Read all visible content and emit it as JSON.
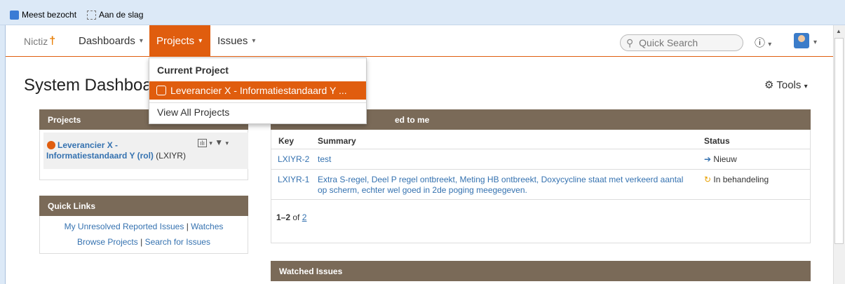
{
  "bookmarks": {
    "most_visited": "Meest bezocht",
    "getting_started": "Aan de slag"
  },
  "header": {
    "logo": "Nictiz",
    "nav": {
      "dashboards": "Dashboards",
      "projects": "Projects",
      "issues": "Issues"
    },
    "search_placeholder": "Quick Search",
    "help_icon": "question-circle-icon",
    "caret": "▾"
  },
  "page": {
    "title": "System Dashboard",
    "tools": "Tools"
  },
  "dropdown": {
    "heading": "Current Project",
    "item": "Leverancier X - Informatiestandaard Y ...",
    "view_all": "View All Projects"
  },
  "projects_gadget": {
    "title": "Projects",
    "project_name": "Leverancier X - Informatiestandaard Y (rol)",
    "project_key": "(LXIYR)"
  },
  "quick_links": {
    "title": "Quick Links",
    "unresolved": "My Unresolved Reported Issues",
    "watches": "Watches",
    "browse": "Browse Projects",
    "search": "Search for Issues",
    "separator": "|"
  },
  "assigned_gadget": {
    "title_visible": "ed to me",
    "columns": {
      "key": "Key",
      "summary": "Summary",
      "status": "Status"
    },
    "rows": [
      {
        "key": "LXIYR-2",
        "summary": "test",
        "status": "Nieuw"
      },
      {
        "key": "LXIYR-1",
        "summary_line1": "Extra S-regel, Deel P regel ontbreekt, Meting HB ontbreekt, Doxycycline staat met verkeerd aantal",
        "summary_line2": "op scherm, echter wel goed in 2de poging meegegeven.",
        "status": "In behandeling"
      }
    ],
    "pager": {
      "range": "1–2",
      "of": "of",
      "total": "2"
    }
  },
  "watched_gadget": {
    "title": "Watched Issues"
  },
  "colors": {
    "accent": "#e05d0e",
    "gadget_header": "#7a6a58",
    "link": "#3572b0"
  }
}
